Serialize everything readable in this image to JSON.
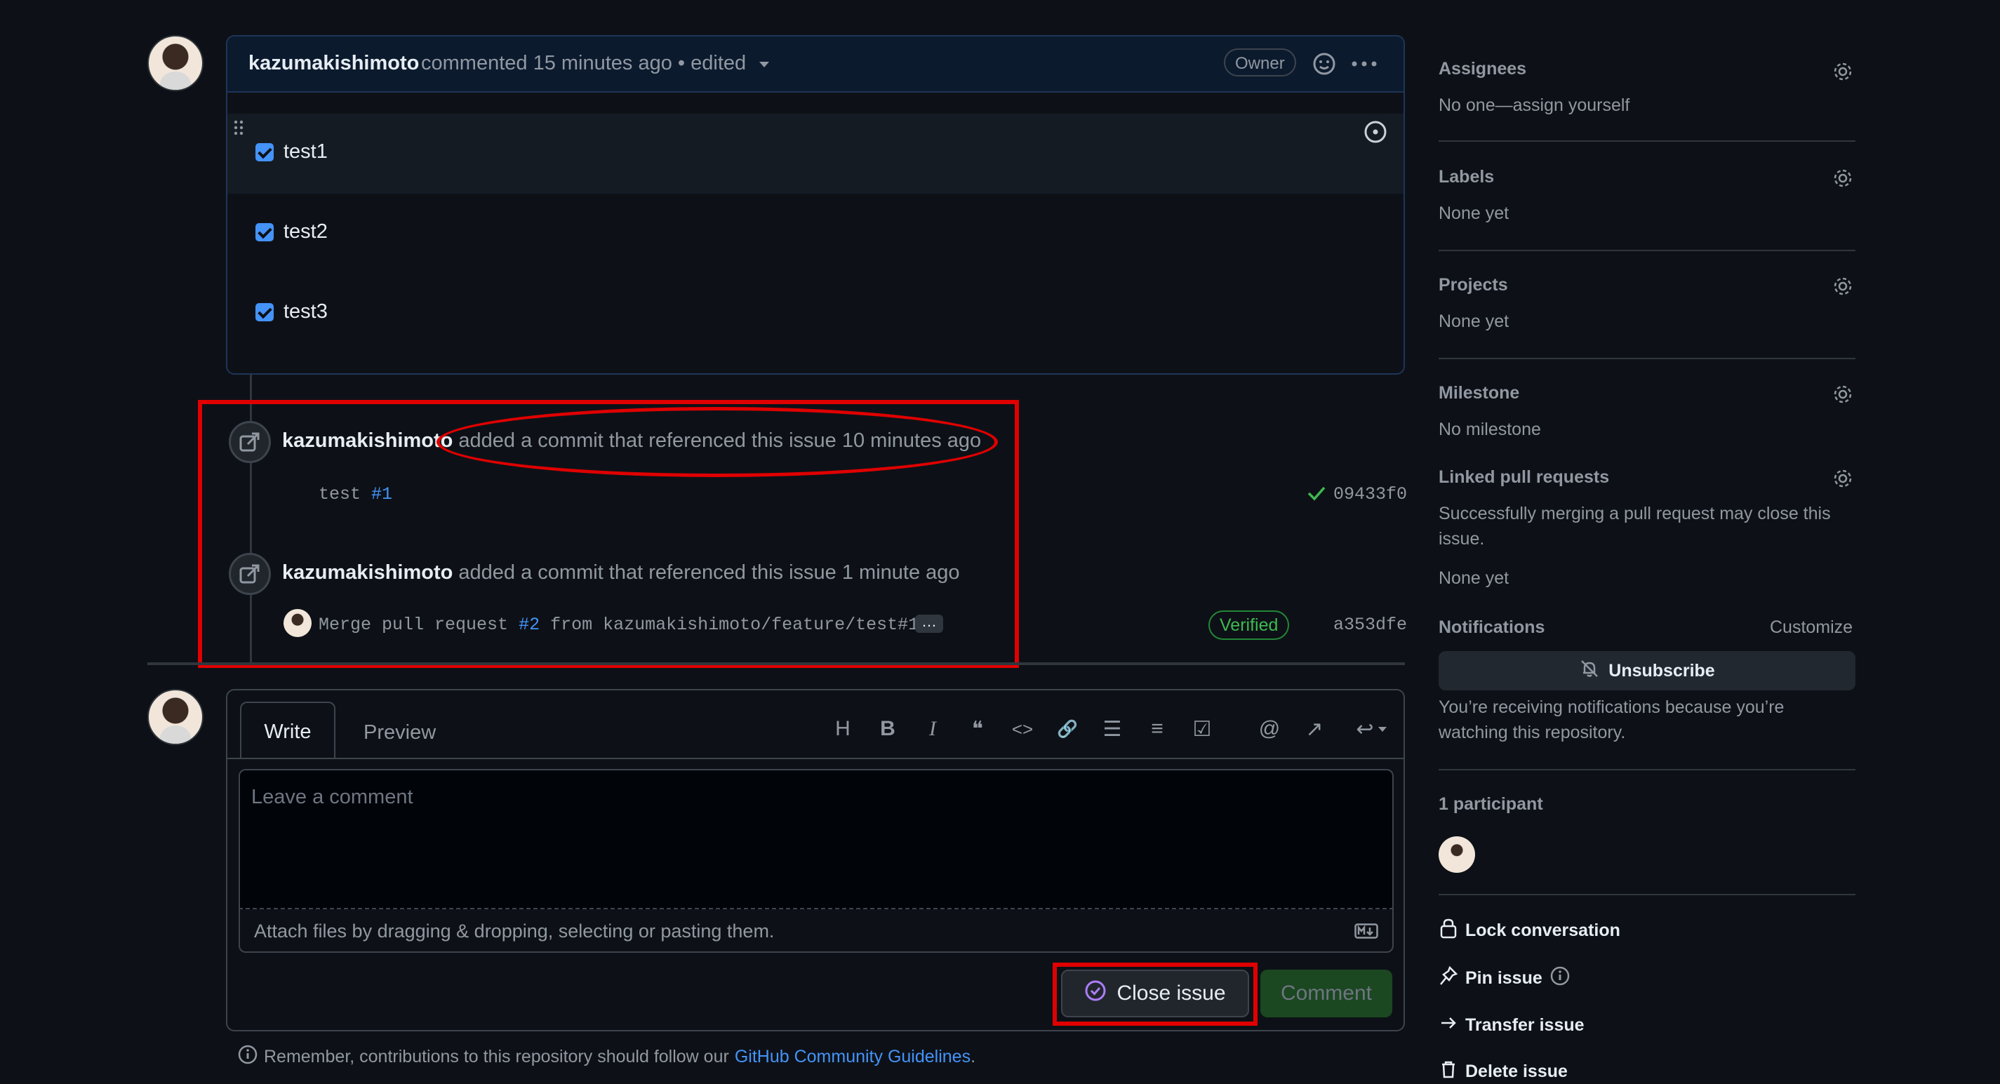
{
  "comment": {
    "author": "kazumakishimoto",
    "meta": "commented 15 minutes ago • edited",
    "owner_badge": "Owner",
    "tasks": [
      "test1",
      "test2",
      "test3"
    ]
  },
  "events": [
    {
      "author": "kazumakishimoto",
      "action": "added a commit that referenced this issue 10 minutes ago",
      "commit_msg": "test",
      "commit_ref": "#1",
      "sha": "09433f0"
    },
    {
      "author": "kazumakishimoto",
      "action": "added a commit that referenced this issue 1 minute ago",
      "commit_msg_prefix": "Merge pull request",
      "commit_ref": "#2",
      "commit_msg_suffix": "from kazumakishimoto/feature/test#1",
      "ellipsis": "…",
      "verified": "Verified",
      "sha": "a353dfe"
    }
  ],
  "composer": {
    "tab_write": "Write",
    "tab_preview": "Preview",
    "placeholder": "Leave a comment",
    "attach_hint": "Attach files by dragging & dropping, selecting or pasting them.",
    "close_label": "Close issue",
    "comment_label": "Comment",
    "toolbar": {
      "heading": "H",
      "bold": "B",
      "italic": "I",
      "quote": "❝",
      "code": "<>",
      "link": "🔗",
      "ul": "☰",
      "ol": "≡",
      "task": "☑",
      "mention": "@",
      "reference": "↗",
      "reply": "↩"
    }
  },
  "guidelines": {
    "prefix": "Remember, contributions to this repository should follow our",
    "link": "GitHub Community Guidelines",
    "suffix": "."
  },
  "sidebar": {
    "assignees": {
      "title": "Assignees",
      "value": "No one—assign yourself"
    },
    "labels": {
      "title": "Labels",
      "value": "None yet"
    },
    "projects": {
      "title": "Projects",
      "value": "None yet"
    },
    "milestone": {
      "title": "Milestone",
      "value": "No milestone"
    },
    "linked": {
      "title": "Linked pull requests",
      "desc": "Successfully merging a pull request may close this issue.",
      "value": "None yet"
    },
    "notifications": {
      "title": "Notifications",
      "customize": "Customize",
      "button": "Unsubscribe",
      "reason": "You’re receiving notifications because you’re watching this repository."
    },
    "participants": {
      "title": "1 participant"
    },
    "actions": {
      "lock": "Lock conversation",
      "pin": "Pin issue",
      "transfer": "Transfer issue",
      "delete": "Delete issue"
    }
  },
  "colors": {
    "accent": "#4493f8",
    "annotation": "#e00000",
    "success": "#3fb950"
  }
}
